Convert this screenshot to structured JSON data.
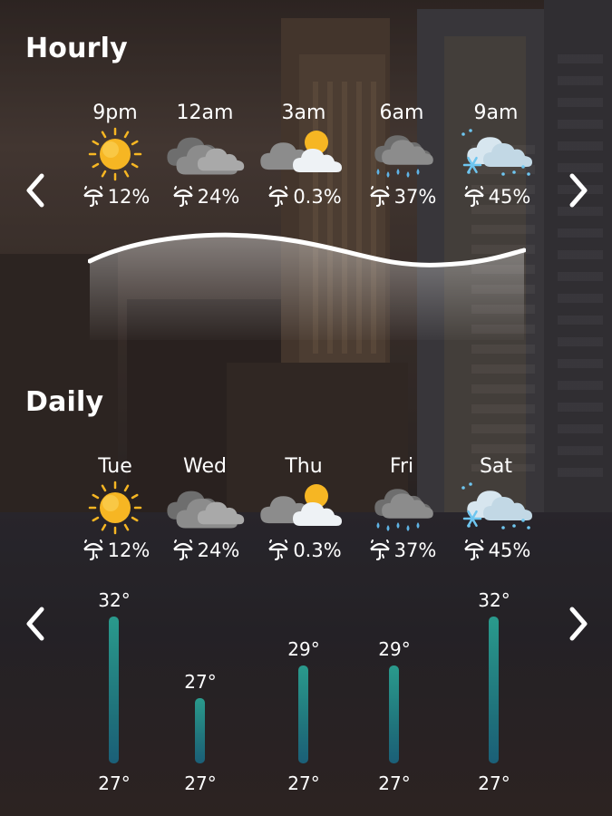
{
  "hourly": {
    "title": "Hourly",
    "items": [
      {
        "label": "9pm",
        "icon": "sun-icon",
        "precip": "12%"
      },
      {
        "label": "12am",
        "icon": "cloudy-icon",
        "precip": "24%"
      },
      {
        "label": "3am",
        "icon": "partly-cloudy-icon",
        "precip": "0.3%"
      },
      {
        "label": "6am",
        "icon": "rain-cloud-icon",
        "precip": "37%"
      },
      {
        "label": "9am",
        "icon": "snow-cloud-icon",
        "precip": "45%"
      }
    ]
  },
  "daily": {
    "title": "Daily",
    "items": [
      {
        "label": "Tue",
        "icon": "sun-icon",
        "precip": "12%",
        "high": "32°",
        "low": "27°",
        "high_value": 32,
        "low_value": 27
      },
      {
        "label": "Wed",
        "icon": "cloudy-icon",
        "precip": "24%",
        "high": "27°",
        "low": "27°",
        "high_value": 27,
        "low_value": 27
      },
      {
        "label": "Thu",
        "icon": "partly-cloudy-icon",
        "precip": "0.3%",
        "high": "29°",
        "low": "27°",
        "high_value": 29,
        "low_value": 27
      },
      {
        "label": "Fri",
        "icon": "rain-cloud-icon",
        "precip": "37%",
        "high": "29°",
        "low": "27°",
        "high_value": 29,
        "low_value": 27
      },
      {
        "label": "Sat",
        "icon": "snow-cloud-icon",
        "precip": "45%",
        "high": "32°",
        "low": "27°",
        "high_value": 32,
        "low_value": 27
      }
    ]
  },
  "colors": {
    "bar": "#2a9a8c",
    "text": "#ffffff",
    "sun": "#f6b623",
    "cloud_dark": "#8c8c8c",
    "cloud_light": "#eef2f5",
    "snow": "#6ec6f0"
  },
  "icons": {
    "prev_hourly": "chevron-left-icon",
    "next_hourly": "chevron-right-icon",
    "prev_daily": "chevron-left-icon",
    "next_daily": "chevron-right-icon",
    "precip": "umbrella-rain-icon"
  }
}
